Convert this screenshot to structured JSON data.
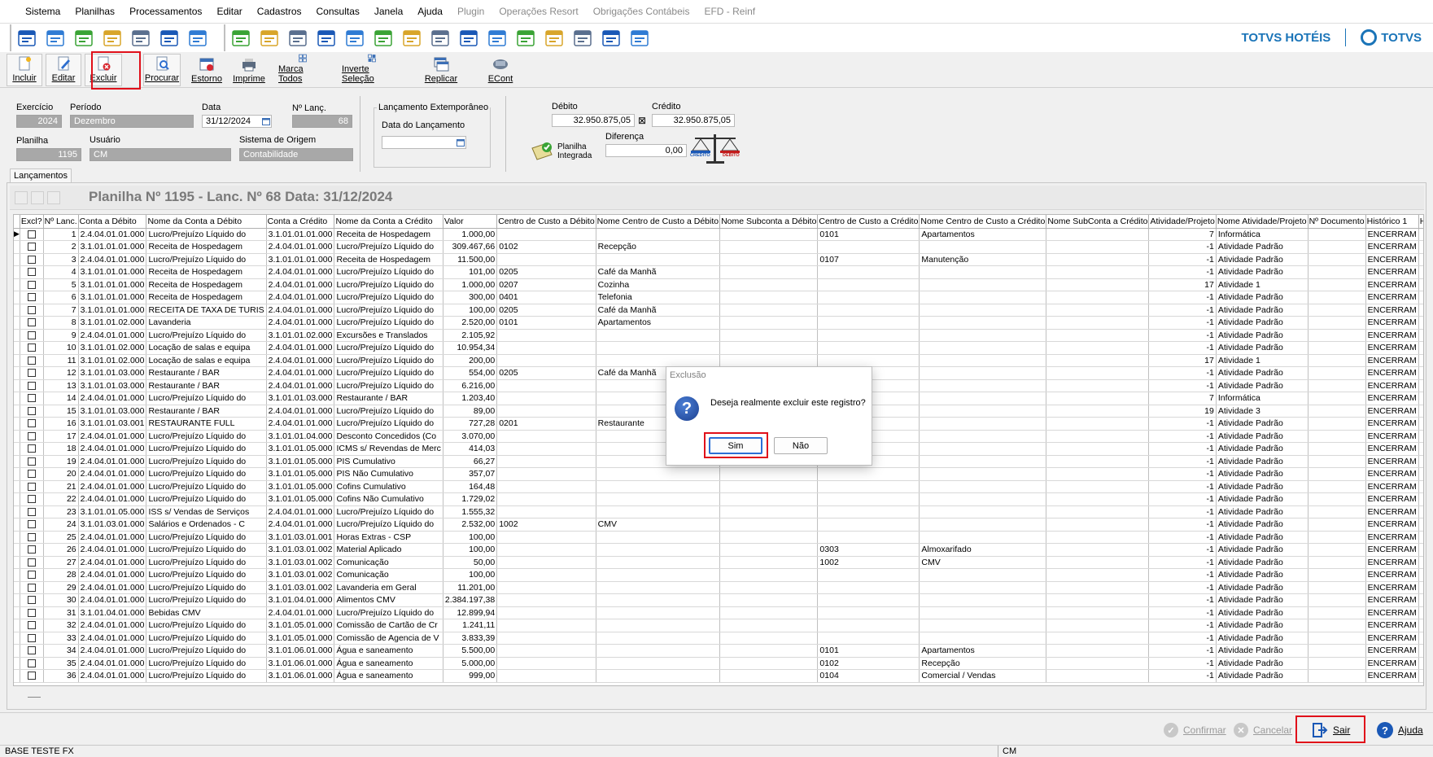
{
  "menu": [
    "Sistema",
    "Planilhas",
    "Processamentos",
    "Editar",
    "Cadastros",
    "Consultas",
    "Janela",
    "Ajuda"
  ],
  "menu_disabled": [
    "Plugin",
    "Operações Resort",
    "Obrigações Contábeis",
    "EFD - Reinf"
  ],
  "brand": {
    "hotel": "TOTVS HOTÉIS",
    "totvs": "TOTVS",
    "color": "#1a74b8"
  },
  "toolbar_icons_a": [
    "exit-door-icon",
    "users-icon",
    "help-icon",
    "org-chart-icon",
    "mail-icon",
    "report-icon",
    "send-mail-icon"
  ],
  "toolbar_icons_b": [
    "coins-refresh-icon",
    "copy-docs-icon",
    "document-icon",
    "calendar-check-icon",
    "calendar-check-2-icon",
    "calendar-search-icon",
    "grid-table-icon",
    "window-layout-icon",
    "window-layout-2-icon",
    "window-layout-3-icon",
    "edit-form-icon",
    "window-add-icon",
    "sun-table-icon",
    "table-search-icon",
    "coins-search-icon"
  ],
  "actions": {
    "incluir": "Incluir",
    "editar": "Editar",
    "excluir": "Excluir",
    "procurar": "Procurar",
    "estorno": "Estorno",
    "imprime": "Imprime",
    "marca_todos": "Marca Todos",
    "inverte": "Inverte Seleção",
    "replicar": "Replicar",
    "econt": "ECont"
  },
  "form": {
    "exercicio_label": "Exercício",
    "exercicio": "2024",
    "periodo_label": "Período",
    "periodo": "Dezembro",
    "data_label": "Data",
    "data": "31/12/2024",
    "nlanc_label": "Nº Lanç.",
    "nlanc": "68",
    "planilha_label": "Planilha",
    "planilha": "1195",
    "usuario_label": "Usuário",
    "usuario": "CM",
    "origem_label": "Sistema de Origem",
    "origem": "Contabilidade",
    "extemporaneo_label": "Lançamento Extemporâneo",
    "data_lancamento_label": "Data do Lançamento",
    "data_lancamento": "",
    "debito_label": "Débito",
    "debito": "32.950.875,05",
    "credito_label": "Crédito",
    "credito": "32.950.875,05",
    "planilha_integrada": "Planilha Integrada",
    "diferenca_label": "Diferença",
    "diferenca": "0,00",
    "balance_credito": "CRÉDITO",
    "balance_debito": "DÉBITO"
  },
  "tab": "Lançamentos",
  "grid_title": "Planilha Nº 1195 - Lanc. Nº 68 Data: 31/12/2024",
  "columns": [
    "Excl?",
    "Nº Lanc.",
    "Conta a Débito",
    "Nome da Conta a Débito",
    "Conta a Crédito",
    "Nome da Conta a Crédito",
    "Valor",
    "Centro de Custo a Débito",
    "Nome Centro de Custo a Débito",
    "Nome Subconta a Débito",
    "Centro de Custo a Crédito",
    "Nome Centro de Custo a Crédito",
    "Nome SubConta a Crédito",
    "Atividade/Projeto",
    "Nome Atividade/Projeto",
    "Nº Documento",
    "Histórico 1",
    "His"
  ],
  "rows": [
    [
      "1",
      "2.4.04.01.01.000",
      "Lucro/Prejuízo Líquido do",
      "3.1.01.01.01.000",
      "Receita de Hospedagem",
      "1.000,00",
      "",
      "",
      "",
      "0101",
      "Apartamentos",
      "",
      "7",
      "Informática",
      "",
      "ENCERRAM"
    ],
    [
      "2",
      "3.1.01.01.01.000",
      "Receita de Hospedagem",
      "2.4.04.01.01.000",
      "Lucro/Prejuízo Líquido do",
      "309.467,66",
      "0102",
      "Recepção",
      "",
      "",
      "",
      "",
      "-1",
      "Atividade Padrão",
      "",
      "ENCERRAM"
    ],
    [
      "3",
      "2.4.04.01.01.000",
      "Lucro/Prejuízo Líquido do",
      "3.1.01.01.01.000",
      "Receita de Hospedagem",
      "11.500,00",
      "",
      "",
      "",
      "0107",
      "Manutenção",
      "",
      "-1",
      "Atividade Padrão",
      "",
      "ENCERRAM"
    ],
    [
      "4",
      "3.1.01.01.01.000",
      "Receita de Hospedagem",
      "2.4.04.01.01.000",
      "Lucro/Prejuízo Líquido do",
      "101,00",
      "0205",
      "Café da Manhã",
      "",
      "",
      "",
      "",
      "-1",
      "Atividade Padrão",
      "",
      "ENCERRAM"
    ],
    [
      "5",
      "3.1.01.01.01.000",
      "Receita de Hospedagem",
      "2.4.04.01.01.000",
      "Lucro/Prejuízo Líquido do",
      "1.000,00",
      "0207",
      "Cozinha",
      "",
      "",
      "",
      "",
      "17",
      "Atividade 1",
      "",
      "ENCERRAM"
    ],
    [
      "6",
      "3.1.01.01.01.000",
      "Receita de Hospedagem",
      "2.4.04.01.01.000",
      "Lucro/Prejuízo Líquido do",
      "300,00",
      "0401",
      "Telefonia",
      "",
      "",
      "",
      "",
      "-1",
      "Atividade Padrão",
      "",
      "ENCERRAM"
    ],
    [
      "7",
      "3.1.01.01.01.000",
      "RECEITA DE TAXA DE TURIS",
      "2.4.04.01.01.000",
      "Lucro/Prejuízo Líquido do",
      "100,00",
      "0205",
      "Café da Manhã",
      "",
      "",
      "",
      "",
      "-1",
      "Atividade Padrão",
      "",
      "ENCERRAM"
    ],
    [
      "8",
      "3.1.01.01.02.000",
      "Lavanderia",
      "2.4.04.01.01.000",
      "Lucro/Prejuízo Líquido do",
      "2.520,00",
      "0101",
      "Apartamentos",
      "",
      "",
      "",
      "",
      "-1",
      "Atividade Padrão",
      "",
      "ENCERRAM"
    ],
    [
      "9",
      "2.4.04.01.01.000",
      "Lucro/Prejuízo Líquido do",
      "3.1.01.01.02.000",
      "Excursões e Translados",
      "2.105,92",
      "",
      "",
      "",
      "",
      "",
      "",
      "-1",
      "Atividade Padrão",
      "",
      "ENCERRAM"
    ],
    [
      "10",
      "3.1.01.01.02.000",
      "Locação de salas e equipa",
      "2.4.04.01.01.000",
      "Lucro/Prejuízo Líquido do",
      "10.954,34",
      "",
      "",
      "",
      "",
      "",
      "",
      "-1",
      "Atividade Padrão",
      "",
      "ENCERRAM"
    ],
    [
      "11",
      "3.1.01.01.02.000",
      "Locação de salas e equipa",
      "2.4.04.01.01.000",
      "Lucro/Prejuízo Líquido do",
      "200,00",
      "",
      "",
      "",
      "",
      "",
      "",
      "17",
      "Atividade 1",
      "",
      "ENCERRAM"
    ],
    [
      "12",
      "3.1.01.01.03.000",
      "Restaurante / BAR",
      "2.4.04.01.01.000",
      "Lucro/Prejuízo Líquido do",
      "554,00",
      "0205",
      "Café da Manhã",
      "",
      "",
      "",
      "",
      "-1",
      "Atividade Padrão",
      "",
      "ENCERRAM"
    ],
    [
      "13",
      "3.1.01.01.03.000",
      "Restaurante / BAR",
      "2.4.04.01.01.000",
      "Lucro/Prejuízo Líquido do",
      "6.216,00",
      "",
      "",
      "",
      "",
      "",
      "",
      "-1",
      "Atividade Padrão",
      "",
      "ENCERRAM"
    ],
    [
      "14",
      "2.4.04.01.01.000",
      "Lucro/Prejuízo Líquido do",
      "3.1.01.01.03.000",
      "Restaurante / BAR",
      "1.203,40",
      "",
      "",
      "",
      "",
      "",
      "",
      "7",
      "Informática",
      "",
      "ENCERRAM"
    ],
    [
      "15",
      "3.1.01.01.03.000",
      "Restaurante / BAR",
      "2.4.04.01.01.000",
      "Lucro/Prejuízo Líquido do",
      "89,00",
      "",
      "",
      "",
      "",
      "",
      "",
      "19",
      "Atividade 3",
      "",
      "ENCERRAM"
    ],
    [
      "16",
      "3.1.01.01.03.001",
      "RESTAURANTE FULL",
      "2.4.04.01.01.000",
      "Lucro/Prejuízo Líquido do",
      "727,28",
      "0201",
      "Restaurante",
      "",
      "",
      "",
      "",
      "-1",
      "Atividade Padrão",
      "",
      "ENCERRAM"
    ],
    [
      "17",
      "2.4.04.01.01.000",
      "Lucro/Prejuízo Líquido do",
      "3.1.01.01.04.000",
      "Desconto Concedidos (Co",
      "3.070,00",
      "",
      "",
      "",
      "",
      "",
      "",
      "-1",
      "Atividade Padrão",
      "",
      "ENCERRAM"
    ],
    [
      "18",
      "2.4.04.01.01.000",
      "Lucro/Prejuízo Líquido do",
      "3.1.01.01.05.000",
      "ICMS s/ Revendas de Merc",
      "414,03",
      "",
      "",
      "",
      "",
      "",
      "",
      "-1",
      "Atividade Padrão",
      "",
      "ENCERRAM"
    ],
    [
      "19",
      "2.4.04.01.01.000",
      "Lucro/Prejuízo Líquido do",
      "3.1.01.01.05.000",
      "PIS Cumulativo",
      "66,27",
      "",
      "",
      "",
      "",
      "",
      "",
      "-1",
      "Atividade Padrão",
      "",
      "ENCERRAM"
    ],
    [
      "20",
      "2.4.04.01.01.000",
      "Lucro/Prejuízo Líquido do",
      "3.1.01.01.05.000",
      "PIS Não Cumulativo",
      "357,07",
      "",
      "",
      "",
      "",
      "",
      "",
      "-1",
      "Atividade Padrão",
      "",
      "ENCERRAM"
    ],
    [
      "21",
      "2.4.04.01.01.000",
      "Lucro/Prejuízo Líquido do",
      "3.1.01.01.05.000",
      "Cofins Cumulativo",
      "164,48",
      "",
      "",
      "",
      "",
      "",
      "",
      "-1",
      "Atividade Padrão",
      "",
      "ENCERRAM"
    ],
    [
      "22",
      "2.4.04.01.01.000",
      "Lucro/Prejuízo Líquido do",
      "3.1.01.01.05.000",
      "Cofins Não Cumulativo",
      "1.729,02",
      "",
      "",
      "",
      "",
      "",
      "",
      "-1",
      "Atividade Padrão",
      "",
      "ENCERRAM"
    ],
    [
      "23",
      "3.1.01.01.05.000",
      "ISS s/ Vendas de Serviços",
      "2.4.04.01.01.000",
      "Lucro/Prejuízo Líquido do",
      "1.555,32",
      "",
      "",
      "",
      "",
      "",
      "",
      "-1",
      "Atividade Padrão",
      "",
      "ENCERRAM"
    ],
    [
      "24",
      "3.1.01.03.01.000",
      "Salários e Ordenados - C",
      "2.4.04.01.01.000",
      "Lucro/Prejuízo Líquido do",
      "2.532,00",
      "1002",
      "CMV",
      "",
      "",
      "",
      "",
      "-1",
      "Atividade Padrão",
      "",
      "ENCERRAM"
    ],
    [
      "25",
      "2.4.04.01.01.000",
      "Lucro/Prejuízo Líquido do",
      "3.1.01.03.01.001",
      "Horas Extras - CSP",
      "100,00",
      "",
      "",
      "",
      "",
      "",
      "",
      "-1",
      "Atividade Padrão",
      "",
      "ENCERRAM"
    ],
    [
      "26",
      "2.4.04.01.01.000",
      "Lucro/Prejuízo Líquido do",
      "3.1.01.03.01.002",
      "Material Aplicado",
      "100,00",
      "",
      "",
      "",
      "0303",
      "Almoxarifado",
      "",
      "-1",
      "Atividade Padrão",
      "",
      "ENCERRAM"
    ],
    [
      "27",
      "2.4.04.01.01.000",
      "Lucro/Prejuízo Líquido do",
      "3.1.01.03.01.002",
      "Comunicação",
      "50,00",
      "",
      "",
      "",
      "1002",
      "CMV",
      "",
      "-1",
      "Atividade Padrão",
      "",
      "ENCERRAM"
    ],
    [
      "28",
      "2.4.04.01.01.000",
      "Lucro/Prejuízo Líquido do",
      "3.1.01.03.01.002",
      "Comunicação",
      "100,00",
      "",
      "",
      "",
      "",
      "",
      "",
      "-1",
      "Atividade Padrão",
      "",
      "ENCERRAM"
    ],
    [
      "29",
      "2.4.04.01.01.000",
      "Lucro/Prejuízo Líquido do",
      "3.1.01.03.01.002",
      "Lavanderia em Geral",
      "11.201,00",
      "",
      "",
      "",
      "",
      "",
      "",
      "-1",
      "Atividade Padrão",
      "",
      "ENCERRAM"
    ],
    [
      "30",
      "2.4.04.01.01.000",
      "Lucro/Prejuízo Líquido do",
      "3.1.01.04.01.000",
      "Alimentos CMV",
      "2.384.197,38",
      "",
      "",
      "",
      "",
      "",
      "",
      "-1",
      "Atividade Padrão",
      "",
      "ENCERRAM"
    ],
    [
      "31",
      "3.1.01.04.01.000",
      "Bebidas CMV",
      "2.4.04.01.01.000",
      "Lucro/Prejuízo Líquido do",
      "12.899,94",
      "",
      "",
      "",
      "",
      "",
      "",
      "-1",
      "Atividade Padrão",
      "",
      "ENCERRAM"
    ],
    [
      "32",
      "2.4.04.01.01.000",
      "Lucro/Prejuízo Líquido do",
      "3.1.01.05.01.000",
      "Comissão de Cartão de Cr",
      "1.241,11",
      "",
      "",
      "",
      "",
      "",
      "",
      "-1",
      "Atividade Padrão",
      "",
      "ENCERRAM"
    ],
    [
      "33",
      "2.4.04.01.01.000",
      "Lucro/Prejuízo Líquido do",
      "3.1.01.05.01.000",
      "Comissão de Agencia de V",
      "3.833,39",
      "",
      "",
      "",
      "",
      "",
      "",
      "-1",
      "Atividade Padrão",
      "",
      "ENCERRAM"
    ],
    [
      "34",
      "2.4.04.01.01.000",
      "Lucro/Prejuízo Líquido do",
      "3.1.01.06.01.000",
      "Água e saneamento",
      "5.500,00",
      "",
      "",
      "",
      "0101",
      "Apartamentos",
      "",
      "-1",
      "Atividade Padrão",
      "",
      "ENCERRAM"
    ],
    [
      "35",
      "2.4.04.01.01.000",
      "Lucro/Prejuízo Líquido do",
      "3.1.01.06.01.000",
      "Água e saneamento",
      "5.000,00",
      "",
      "",
      "",
      "0102",
      "Recepção",
      "",
      "-1",
      "Atividade Padrão",
      "",
      "ENCERRAM"
    ],
    [
      "36",
      "2.4.04.01.01.000",
      "Lucro/Prejuízo Líquido do",
      "3.1.01.06.01.000",
      "Água e saneamento",
      "999,00",
      "",
      "",
      "",
      "0104",
      "Comercial / Vendas",
      "",
      "-1",
      "Atividade Padrão",
      "",
      "ENCERRAM"
    ]
  ],
  "dialog": {
    "title": "Exclusão",
    "message": "Deseja realmente excluir este registro?",
    "yes": "Sim",
    "no": "Não"
  },
  "bottom": {
    "confirmar": "Confirmar",
    "cancelar": "Cancelar",
    "sair": "Sair",
    "ajuda": "Ajuda"
  },
  "status": {
    "left": "BASE TESTE FX",
    "right": "CM"
  },
  "colors": {
    "highlight": "#e0101a",
    "accent": "#1a74b8"
  }
}
